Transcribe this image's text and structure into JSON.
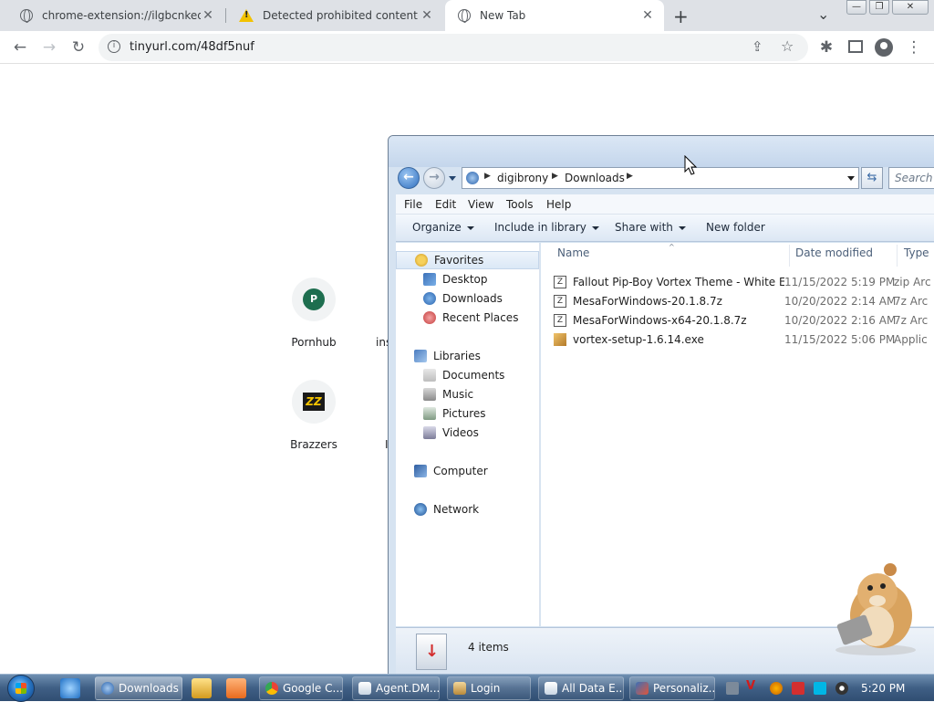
{
  "browser": {
    "tabs": [
      {
        "title": "chrome-extension://ilgbcnkedm",
        "active": false
      },
      {
        "title": "Detected prohibited content",
        "active": false
      },
      {
        "title": "New Tab",
        "active": true
      }
    ],
    "new_tab_symbol": "+",
    "tab_search_symbol": "⌄",
    "url": "tinyurl.com/48df5nuf"
  },
  "newtab": {
    "shortcuts": [
      {
        "label": "Pornhub",
        "icon_letter": "P"
      },
      {
        "label": "ins",
        "icon_letter": ""
      },
      {
        "label": "Brazzers",
        "icon_letter": "ZZ"
      },
      {
        "label": "I",
        "icon_letter": ""
      }
    ]
  },
  "explorer": {
    "breadcrumb": [
      "digibrony",
      "Downloads"
    ],
    "search_placeholder": "Search D",
    "menu": [
      "File",
      "Edit",
      "View",
      "Tools",
      "Help"
    ],
    "commands": [
      {
        "label": "Organize",
        "has_arrow": true
      },
      {
        "label": "Include in library",
        "has_arrow": true
      },
      {
        "label": "Share with",
        "has_arrow": true
      },
      {
        "label": "New folder",
        "has_arrow": false
      }
    ],
    "nav": {
      "favorites_label": "Favorites",
      "favorites": [
        "Desktop",
        "Downloads",
        "Recent Places"
      ],
      "libraries_label": "Libraries",
      "libraries": [
        "Documents",
        "Music",
        "Pictures",
        "Videos"
      ],
      "computer_label": "Computer",
      "network_label": "Network"
    },
    "columns": [
      "Name",
      "Date modified",
      "Type"
    ],
    "files": [
      {
        "name": "Fallout Pip-Boy Vortex Theme - White Ed...",
        "date": "11/15/2022 5:19 PM",
        "type": "zip Arc"
      },
      {
        "name": "MesaForWindows-20.1.8.7z",
        "date": "10/20/2022 2:14 AM",
        "type": "7z Arc"
      },
      {
        "name": "MesaForWindows-x64-20.1.8.7z",
        "date": "10/20/2022 2:16 AM",
        "type": "7z Arc"
      },
      {
        "name": "vortex-setup-1.6.14.exe",
        "date": "11/15/2022 5:06 PM",
        "type": "Applic"
      }
    ],
    "status": "4 items"
  },
  "taskbar": {
    "buttons": [
      {
        "label": "Downloads",
        "active": true
      },
      {
        "label": "Google C...",
        "active": false
      },
      {
        "label": "Agent.DM...",
        "active": false
      },
      {
        "label": "Login",
        "active": false
      },
      {
        "label": "All Data E...",
        "active": false
      },
      {
        "label": "Personaliz...",
        "active": false
      }
    ],
    "clock": "5:20 PM"
  },
  "colors": {
    "chrome_tabstrip": "#dee1e6",
    "explorer_frame": "#d6e3f1",
    "taskbar": "#3f5f85"
  }
}
